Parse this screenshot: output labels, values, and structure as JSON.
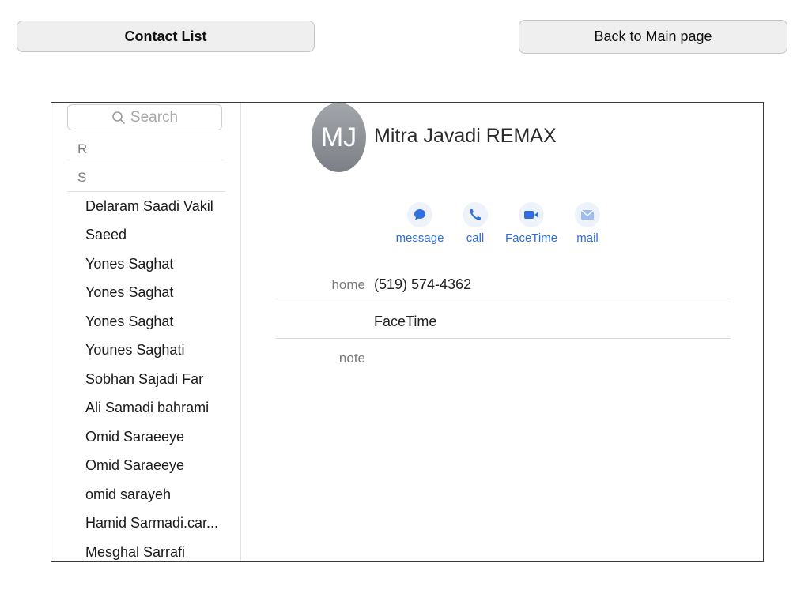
{
  "top_buttons": {
    "contact_list": "Contact List",
    "back_to_main": "Back to Main page"
  },
  "sidebar": {
    "search_placeholder": "Search",
    "sections": [
      "R",
      "S"
    ],
    "contacts": [
      "Delaram Saadi Vakil",
      "Saeed",
      "Yones Saghat",
      "Yones Saghat",
      "Yones Saghat",
      "Younes Saghati",
      "Sobhan Sajadi Far",
      "Ali Samadi bahrami",
      "Omid Saraeeye",
      "Omid Saraeeye",
      "omid sarayeh",
      "Hamid Sarmadi.car...",
      "Mesghal Sarrafi"
    ]
  },
  "detail": {
    "initials": "MJ",
    "name": "Mitra Javadi REMAX",
    "actions": {
      "message": "message",
      "call": "call",
      "facetime": "FaceTime",
      "mail": "mail"
    },
    "phone_label": "home",
    "phone_value": "(519) 574-4362",
    "facetime_value": "FaceTime",
    "note_label": "note"
  },
  "colors": {
    "accent": "#2f6fe0",
    "button_bg": "#efefef"
  }
}
